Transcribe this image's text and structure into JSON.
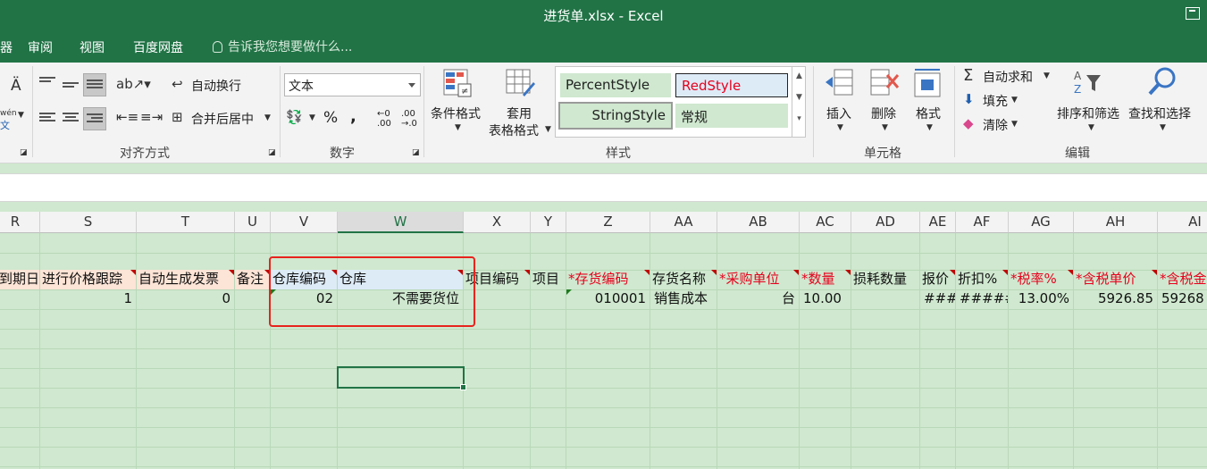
{
  "title": "进货单.xlsx - Excel",
  "tabs": [
    {
      "label": "审阅"
    },
    {
      "label": "视图"
    },
    {
      "label": "百度网盘"
    }
  ],
  "tab_edge": "器",
  "tell_me": "告诉我您想要做什么...",
  "ribbon": {
    "font_fragments": [
      "Ä",
      "wén",
      "文"
    ],
    "alignment": {
      "wrap_text": "自动换行",
      "merge_center": "合并后居中",
      "group": "对齐方式"
    },
    "number": {
      "format": "文本",
      "percent": "%",
      "comma": ",",
      "inc_decimal": "←0 .00",
      "dec_decimal": ".00 →.0",
      "group": "数字"
    },
    "styles": {
      "conditional": "条件格式",
      "table_format_1": "套用",
      "table_format_2": "表格格式",
      "cells": [
        "PercentStyle",
        "RedStyle",
        "StringStyle",
        "常规"
      ],
      "group": "样式"
    },
    "cells": {
      "insert": "插入",
      "delete": "删除",
      "format": "格式",
      "group": "单元格"
    },
    "editing": {
      "autosum": "自动求和",
      "fill": "填充",
      "clear": "清除",
      "sort_filter": "排序和筛选",
      "find_select": "查找和选择",
      "group": "编辑"
    }
  },
  "colors": {
    "excel_green": "#217346",
    "sheet_bg": "#cfe8cf",
    "red_highlight": "#e8231d",
    "required_red": "#e8001c"
  },
  "columns": [
    "R",
    "S",
    "T",
    "U",
    "V",
    "W",
    "X",
    "Y",
    "Z",
    "AA",
    "AB",
    "AC",
    "AD",
    "AE",
    "AF",
    "AG",
    "AH",
    "AI"
  ],
  "header_row": [
    "到期日",
    "进行价格跟踪",
    "自动生成发票",
    "备注",
    "仓库编码",
    "仓库",
    "项目编码",
    "项目",
    "*存货编码",
    "存货名称",
    "*采购单位",
    "*数量",
    "损耗数量",
    "报价",
    "折扣%",
    "*税率%",
    "*含税单价",
    "*含税金"
  ],
  "data_row": [
    "",
    "1",
    "0",
    "",
    "02",
    "不需要货位",
    "",
    "",
    "010001",
    "销售成本",
    "台",
    "10.00",
    "",
    "###",
    "#####",
    "13.00%",
    "5926.85",
    "59268"
  ]
}
